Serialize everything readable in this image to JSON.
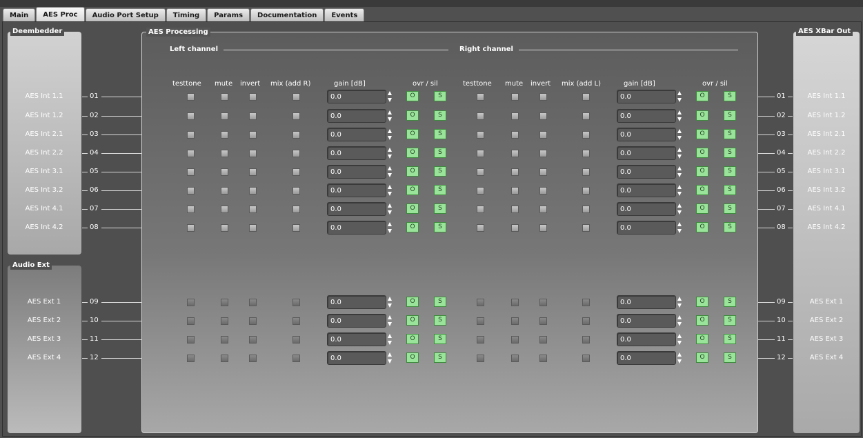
{
  "tabs": [
    {
      "label": "Main",
      "active": false
    },
    {
      "label": "AES Proc",
      "active": true
    },
    {
      "label": "Audio Port Setup",
      "active": false
    },
    {
      "label": "Timing",
      "active": false
    },
    {
      "label": "Params",
      "active": false
    },
    {
      "label": "Documentation",
      "active": false
    },
    {
      "label": "Events",
      "active": false
    }
  ],
  "panels": {
    "deembedder": "Deembedder",
    "audio_ext": "Audio Ext",
    "aes_processing": "AES Processing",
    "aes_xbar_out": "AES XBar Out"
  },
  "sections": {
    "left": "Left channel",
    "right": "Right channel"
  },
  "columns": {
    "left": {
      "testtone": "testtone",
      "mute": "mute",
      "invert": "invert",
      "mix": "mix (add R)",
      "gain": "gain [dB]",
      "ovr_sil": "ovr / sil"
    },
    "right": {
      "testtone": "testtone",
      "mute": "mute",
      "invert": "invert",
      "mix": "mix (add L)",
      "gain": "gain [dB]",
      "ovr_sil": "ovr / sil"
    }
  },
  "button_labels": {
    "ovr": "O",
    "sil": "S"
  },
  "rows": [
    {
      "num": "01",
      "in": "AES Int 1.1",
      "out": "AES Int 1.1",
      "gain_l": "0.0",
      "gain_r": "0.0"
    },
    {
      "num": "02",
      "in": "AES Int 1.2",
      "out": "AES Int 1.2",
      "gain_l": "0.0",
      "gain_r": "0.0"
    },
    {
      "num": "03",
      "in": "AES Int 2.1",
      "out": "AES Int 2.1",
      "gain_l": "0.0",
      "gain_r": "0.0"
    },
    {
      "num": "04",
      "in": "AES Int 2.2",
      "out": "AES Int 2.2",
      "gain_l": "0.0",
      "gain_r": "0.0"
    },
    {
      "num": "05",
      "in": "AES Int 3.1",
      "out": "AES Int 3.1",
      "gain_l": "0.0",
      "gain_r": "0.0"
    },
    {
      "num": "06",
      "in": "AES Int 3.2",
      "out": "AES Int 3.2",
      "gain_l": "0.0",
      "gain_r": "0.0"
    },
    {
      "num": "07",
      "in": "AES Int 4.1",
      "out": "AES Int 4.1",
      "gain_l": "0.0",
      "gain_r": "0.0"
    },
    {
      "num": "08",
      "in": "AES Int 4.2",
      "out": "AES Int 4.2",
      "gain_l": "0.0",
      "gain_r": "0.0"
    },
    {
      "num": "09",
      "in": "AES Ext 1",
      "out": "AES Ext 1",
      "gain_l": "0.0",
      "gain_r": "0.0"
    },
    {
      "num": "10",
      "in": "AES Ext 2",
      "out": "AES Ext 2",
      "gain_l": "0.0",
      "gain_r": "0.0"
    },
    {
      "num": "11",
      "in": "AES Ext 3",
      "out": "AES Ext 3",
      "gain_l": "0.0",
      "gain_r": "0.0"
    },
    {
      "num": "12",
      "in": "AES Ext 4",
      "out": "AES Ext 4",
      "gain_l": "0.0",
      "gain_r": "0.0"
    }
  ],
  "colors": {
    "button_green": "#9ae39a",
    "panel_border": "#d0d0d0"
  }
}
